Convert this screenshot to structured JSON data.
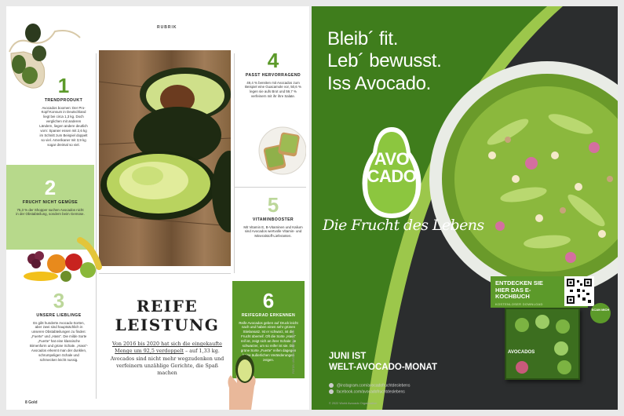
{
  "left_page": {
    "rubrik": "RUBRIK",
    "items": [
      {
        "number": "1",
        "title": "TRENDPRODUKT",
        "text": "Avocados boomen: Der Pro-Kopf-Konsum in Deutschland liegt bei circa 1,3 kg. Doch verglichen mit anderen Ländern, liegen andere deutlich vorn: Spanier essen mit 2,6 kg im Schnitt zum Beispiel doppelt so viel. Amerikaner mit 3,9 kg sogar dreimal so viel."
      },
      {
        "number": "2",
        "title": "FRUCHT NICHT GEMÜSE",
        "text": "75,3 % der Shopper suchen Avocados nicht in der Obstabteilung, sondern beim Gemüse."
      },
      {
        "number": "3",
        "title": "UNSERE LIEBLINGE",
        "text": "Es gibt hunderte Avocado-Sorten, aber zwei sind hauptsächlich in unseren Obstabteilungen zu finden: „Fuerte“ und „Hass“. Die milde Sorte „Fuerte“ hat eine klassische Birnenform und grüne Schale. „Hass“-Avocados erkennt man der dunklen, schrumpeligen Schale und schmecken leicht nussig."
      },
      {
        "number": "4",
        "title": "PASST HERVORRAGEND",
        "text": "49,4 % bereiten mit Avocados zum Beispiel eine Guacamole vor, 50,6 % legen sie aufs Brot und 59,7 % verfeinern mit ihr ihre Salate."
      },
      {
        "number": "5",
        "title": "VITAMINBOOSTER",
        "text": "Mit Vitamin E, B-Vitaminen und Kalium sind Avocados wertvolle Vitamin- und Mineralstoff-Lieferanten."
      },
      {
        "number": "6",
        "title": "REIFEGRAD ERKENNEN",
        "text": "Reife Avocados geben auf Druck leicht nach und haben einen sehr grünen Stielansatz. Ist er schwarz, ist die Frucht überreif. Oft die Sorte „Hass“ reif ist, zeigt sich an ihrer Schale: Je schwarzer, um so reifer ist sie. Die grüne Sorte „Fuerte“ reifen dagegen keine äußerlichen Veränderungen zeigen."
      }
    ],
    "headline_line1": "REIFE",
    "headline_line2": "LEISTUNG",
    "lead_underlined": "Von 2016 bis 2020 hat sich die eingekaufte Menge um 92,5 verdoppelt",
    "lead_rest": "– auf 1,33 kg. Avocados sind nicht mehr wegzudenken und verfeinern unzählige Gerichte, die Spaß machen",
    "folio": "8 Gold",
    "photo_credit": "FOTOS: UNSPLASH/ADOBESTOCK"
  },
  "right_page": {
    "headline": [
      "Bleib´ fit.",
      "Leb´ bewusst.",
      "Iss Avocado."
    ],
    "logo_line1": "AVO",
    "logo_line2": "CADO",
    "tagline": "Die Frucht des Lebens",
    "promo_title": "ENTDECKEN SIE HIER DAS E-KOCHBUCH",
    "promo_sub": "KOSTENLOSER DOWNLOAD",
    "scan_label": "SCAN MICH",
    "book_title": "AVOCADOS",
    "event_line1": "JUNI IST",
    "event_line2": "WELT-AVOCADO-MONAT",
    "social_instagram": "@instagram.com/avocadofruchtdeslebens",
    "social_facebook": "facebook.com/avocadofruchtdeslebens",
    "copyright": "© 2022 World Avocado Organization",
    "colors": {
      "accent_green": "#5c9a2a",
      "light_green": "#b7d98b",
      "dark_bg": "#2b2d2e"
    }
  }
}
